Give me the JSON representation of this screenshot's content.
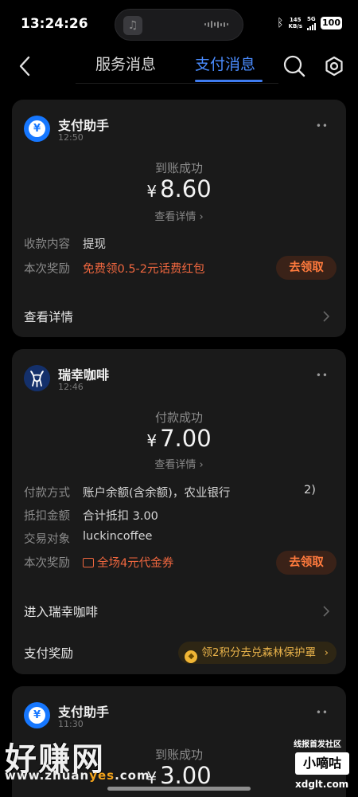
{
  "statusbar": {
    "time": "13:24:26",
    "net_speed_value": "145",
    "net_speed_unit": "KB/s",
    "network": "5G",
    "battery": "100",
    "bluetooth_icon": "bluetooth-icon",
    "music_app_icon": "music-note-icon"
  },
  "navbar": {
    "tab_service": "服务消息",
    "tab_payment": "支付消息",
    "active_tab": "支付消息",
    "accent_color": "#3f7cf0"
  },
  "messages": [
    {
      "sender": "支付助手",
      "time": "12:50",
      "status": "到账成功",
      "currency": "¥",
      "amount": "8.60",
      "detail_link": "查看详情",
      "rows": [
        {
          "label": "收款内容",
          "value": "提现"
        },
        {
          "label": "本次奖励",
          "value": "免费领0.5-2元话费红包"
        }
      ],
      "claim_button": "去领取",
      "footer_link": "查看详情"
    },
    {
      "sender": "瑞幸咖啡",
      "time": "12:46",
      "status": "付款成功",
      "currency": "¥",
      "amount": "7.00",
      "detail_link": "查看详情",
      "rows": [
        {
          "label": "付款方式",
          "value": "账户余额(含余额)，农业银行",
          "value_tail": "2)"
        },
        {
          "label": "抵扣金额",
          "value": "合计抵扣 3.00"
        },
        {
          "label": "交易对象",
          "value": "luckincoffee"
        },
        {
          "label": "本次奖励",
          "value": "全场4元代金券"
        }
      ],
      "claim_button": "去领取",
      "footer_link": "进入瑞幸咖啡",
      "reward_row": {
        "label": "支付奖励",
        "pill": "领2积分去兑森林保护罩"
      }
    },
    {
      "sender": "支付助手",
      "time": "11:30",
      "status": "到账成功",
      "currency": "¥",
      "amount": "3.00"
    }
  ],
  "watermark": {
    "big": "好赚网",
    "url_prefix": "www.zhuan",
    "url_accent": "yes",
    "url_suffix": ".com",
    "right_top": "线报首发社区",
    "right_box": "小嘀咕",
    "right_domain": "xdglt.com"
  }
}
